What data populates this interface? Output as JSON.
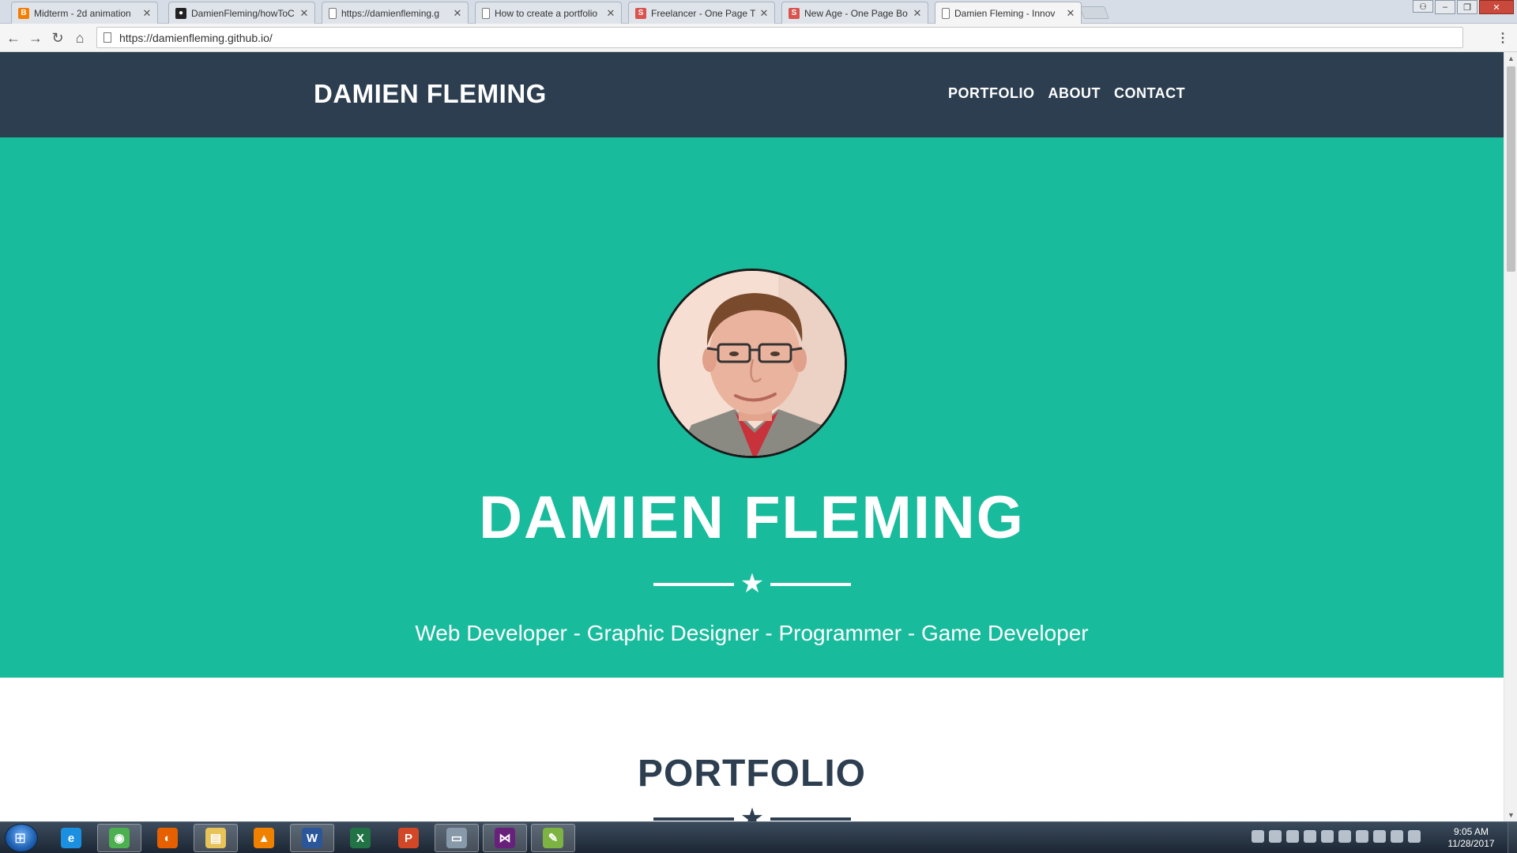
{
  "browser": {
    "tabs": [
      {
        "title": "Midterm - 2d animation",
        "favicon": "blogger-icon",
        "favicon_color": "#f57d00",
        "favicon_glyph": "B"
      },
      {
        "title": "DamienFleming/howToC",
        "favicon": "github-icon",
        "favicon_color": "#222222",
        "favicon_glyph": "●"
      },
      {
        "title": "https://damienfleming.g",
        "favicon": "page-icon",
        "favicon_color": "#ffffff",
        "favicon_glyph": ""
      },
      {
        "title": "How to create a portfolio",
        "favicon": "page-icon",
        "favicon_color": "#ffffff",
        "favicon_glyph": ""
      },
      {
        "title": "Freelancer - One Page Th",
        "favicon": "startbootstrap-icon",
        "favicon_color": "#d9534f",
        "favicon_glyph": "S"
      },
      {
        "title": "New Age - One Page Bo",
        "favicon": "startbootstrap-icon",
        "favicon_color": "#d9534f",
        "favicon_glyph": "S"
      },
      {
        "title": "Damien Fleming - Innov",
        "favicon": "page-icon",
        "favicon_color": "#ffffff",
        "favicon_glyph": ""
      }
    ],
    "active_tab_index": 6,
    "url": "https://damienfleming.github.io/"
  },
  "site": {
    "brand": "DAMIEN FLEMING",
    "nav": [
      "PORTFOLIO",
      "ABOUT",
      "CONTACT"
    ],
    "hero": {
      "name": "DAMIEN FLEMING",
      "skills": "Web Developer - Graphic Designer - Programmer - Game Developer",
      "divider_icon": "star-icon"
    },
    "portfolio_heading": "PORTFOLIO",
    "colors": {
      "navbar": "#2c3e50",
      "hero": "#18bc9c",
      "heading": "#2c3e50"
    }
  },
  "taskbar": {
    "apps": [
      {
        "name": "internet-explorer-icon",
        "glyph": "e",
        "color": "#1b8fe0",
        "active": false
      },
      {
        "name": "chrome-icon",
        "glyph": "◉",
        "color": "#4caf50",
        "active": true
      },
      {
        "name": "firefox-icon",
        "glyph": "◐",
        "color": "#e66000",
        "active": false
      },
      {
        "name": "file-explorer-icon",
        "glyph": "▤",
        "color": "#e8c35a",
        "active": true
      },
      {
        "name": "vlc-icon",
        "glyph": "▲",
        "color": "#f08000",
        "active": false
      },
      {
        "name": "word-icon",
        "glyph": "W",
        "color": "#2b579a",
        "active": true
      },
      {
        "name": "excel-icon",
        "glyph": "X",
        "color": "#217346",
        "active": false
      },
      {
        "name": "powerpoint-icon",
        "glyph": "P",
        "color": "#d24726",
        "active": false
      },
      {
        "name": "window-icon",
        "glyph": "▭",
        "color": "#8899aa",
        "active": true
      },
      {
        "name": "visual-studio-icon",
        "glyph": "⋈",
        "color": "#68217a",
        "active": true
      },
      {
        "name": "notepad-icon",
        "glyph": "✎",
        "color": "#7cb342",
        "active": true
      }
    ],
    "time": "9:05 AM",
    "date": "11/28/2017"
  }
}
